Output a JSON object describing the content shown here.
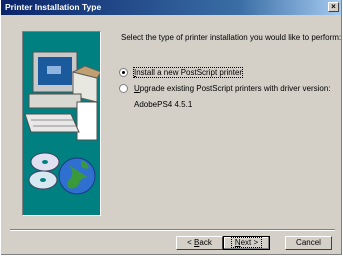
{
  "window": {
    "title": "Printer Installation Type",
    "close_label": "×"
  },
  "main": {
    "prompt": "Select the type of printer installation you would like to perform:",
    "options": [
      {
        "label_prefix": "",
        "label_mnemonic": "I",
        "label_rest": "nstall a new PostScript printer",
        "checked": true
      },
      {
        "label_prefix": "",
        "label_mnemonic": "U",
        "label_rest": "pgrade existing PostScript printers with driver version:",
        "checked": false
      }
    ],
    "driver_version": "AdobePS4 4.5.1"
  },
  "buttons": {
    "back": {
      "prefix": "< ",
      "mnemonic": "B",
      "rest": "ack"
    },
    "next": {
      "prefix": "",
      "mnemonic": "N",
      "rest": "ext >"
    },
    "cancel": "Cancel"
  },
  "colors": {
    "title_bar": "#0a246a",
    "dialog_face": "#d4d0c8",
    "art_background": "#008080"
  }
}
